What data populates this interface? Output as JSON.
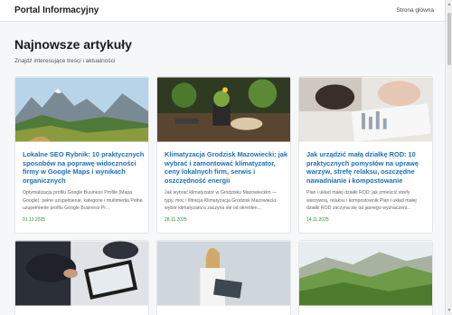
{
  "header": {
    "brand": "Portal Informacyjny",
    "nav_home": "Strona główna"
  },
  "page": {
    "title": "Najnowsze artykuły",
    "subtitle": "Znajdź interesujące treści i aktualności"
  },
  "articles": [
    {
      "title": "Lokalne SEO Rybnik: 10 praktycznych sposobów na poprawę widoczności firmy w Google Maps i wynikach organicznych",
      "excerpt": "Optymalizacja profilu Google Business Profile (Mapa Google): pełne uzupełnienie, kategorie i multimedia Pełne uzupełnienie profilu Google Business Pr...",
      "date": "01.12.2025"
    },
    {
      "title": "Klimatyzacja Grodzisk Mazowiecki: jak wybrać i zamontować klimatyzator, ceny lokalnych firm, serwis i oszczędność energii",
      "excerpt": "Jak wybrać klimatyzator w Grodzisku Mazowieckim — typy, moc i filtracja Klimatyzacja Grodzisk Mazowiecki: wybór klimatyzatora zaczyna się od określen...",
      "date": "28.11.2025"
    },
    {
      "title": "Jak urządzić małą działkę ROD: 10 praktycznych pomysłów na uprawę warzyw, strefę relaksu, oszczędne nawadnianie i kompostowanie",
      "excerpt": "Plan i układ małej działki ROD: jak zmieścić strefy warzywną, relaksu i kompostownik Plan i układ małej działki ROD zaczyna się od jasnego wyznaczeni...",
      "date": "14.11.2025"
    }
  ]
}
